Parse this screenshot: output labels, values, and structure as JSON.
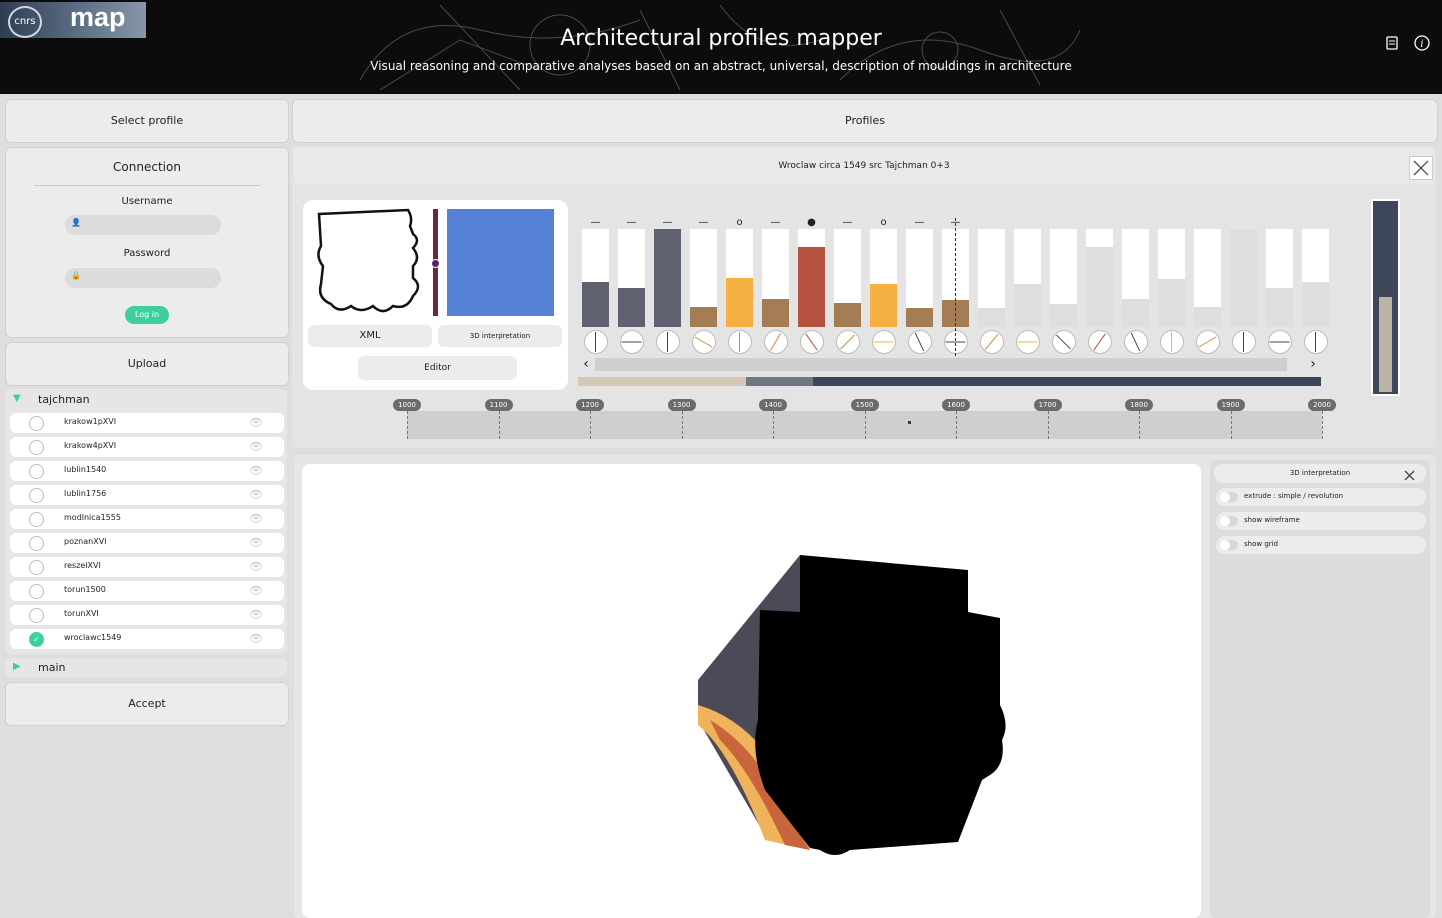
{
  "header": {
    "logo_cnrs": "cnrs",
    "logo_map": "map",
    "title": "Architectural profiles mapper",
    "subtitle": "Visual reasoning and comparative analyses based on an abstract, universal, description of mouldings in architecture",
    "icons": [
      "book-icon",
      "info-icon"
    ]
  },
  "left": {
    "select_profile_label": "Select profile",
    "connection": {
      "title": "Connection",
      "username_label": "Username",
      "password_label": "Password",
      "username_value": "",
      "password_value": "",
      "login_label": "Log in"
    },
    "upload_label": "Upload",
    "tree": {
      "group1": "tajchman",
      "items": [
        {
          "label": "krakow1pXVI",
          "checked": false
        },
        {
          "label": "krakow4pXVI",
          "checked": false
        },
        {
          "label": "lublin1540",
          "checked": false
        },
        {
          "label": "lublin1756",
          "checked": false
        },
        {
          "label": "modlnica1555",
          "checked": false
        },
        {
          "label": "poznanXVI",
          "checked": false
        },
        {
          "label": "reszelXVI",
          "checked": false
        },
        {
          "label": "torun1500",
          "checked": false
        },
        {
          "label": "torunXVI",
          "checked": false
        },
        {
          "label": "wroclawc1549",
          "checked": true
        }
      ],
      "group2": "main"
    },
    "accept_label": "Accept"
  },
  "profiles": {
    "tab_label": "Profiles",
    "profile_title": "Wroclaw circa 1549 src Tajchman 0+3",
    "xml_label": "XML",
    "interp_label": "3D interpretation",
    "editor_label": "Editor",
    "prev_arrow": "‹",
    "next_arrow": "›",
    "bars": [
      {
        "value": 0.46,
        "color": "#5f6170",
        "marker": "—"
      },
      {
        "value": 0.4,
        "color": "#5f6170",
        "marker": "—"
      },
      {
        "value": 1.0,
        "color": "#5f6170",
        "marker": "—"
      },
      {
        "value": 0.2,
        "color": "#a47d55",
        "marker": "—"
      },
      {
        "value": 0.5,
        "color": "#f4b040",
        "marker": "o"
      },
      {
        "value": 0.29,
        "color": "#a47d55",
        "marker": "—"
      },
      {
        "value": 0.82,
        "color": "#b85240",
        "marker": "●"
      },
      {
        "value": 0.24,
        "color": "#a47d55",
        "marker": "—"
      },
      {
        "value": 0.44,
        "color": "#f4b040",
        "marker": "o"
      },
      {
        "value": 0.19,
        "color": "#a47d55",
        "marker": "—"
      },
      {
        "value": 0.28,
        "color": "#a47d55",
        "marker": "—"
      },
      {
        "value": 0.19,
        "color": "#dedede",
        "marker": ""
      },
      {
        "value": 0.44,
        "color": "#dedede",
        "marker": ""
      },
      {
        "value": 0.23,
        "color": "#dedede",
        "marker": ""
      },
      {
        "value": 0.82,
        "color": "#dedede",
        "marker": ""
      },
      {
        "value": 0.29,
        "color": "#dedede",
        "marker": ""
      },
      {
        "value": 0.49,
        "color": "#dedede",
        "marker": ""
      },
      {
        "value": 0.2,
        "color": "#dedede",
        "marker": ""
      },
      {
        "value": 1.0,
        "color": "#dedede",
        "marker": ""
      },
      {
        "value": 0.4,
        "color": "#dedede",
        "marker": ""
      },
      {
        "value": 0.46,
        "color": "#dedede",
        "marker": ""
      }
    ],
    "dial_angles": [
      0,
      90,
      0,
      -60,
      0,
      30,
      -35,
      45,
      90,
      -25,
      90,
      40,
      90,
      -45,
      35,
      -25,
      0,
      60,
      0,
      90,
      0
    ],
    "dial_colors": [
      "#444",
      "#444",
      "#444",
      "#c84",
      "#c84",
      "#c84",
      "#b85240",
      "#c84",
      "#f4b040",
      "#444",
      "#444",
      "#c84",
      "#f4b040",
      "#444",
      "#b85240",
      "#444",
      "#f4b040",
      "#c84",
      "#444",
      "#444",
      "#444"
    ],
    "timeline": {
      "ticks": [
        "1000",
        "1100",
        "1200",
        "1300",
        "1400",
        "1500",
        "1600",
        "1700",
        "1800",
        "1900",
        "2000"
      ],
      "marker_year": 1549
    }
  },
  "viewer": {
    "panel_title": "3D interpretation",
    "toggles": [
      {
        "label": "extrude : simple / revolution",
        "on": false
      },
      {
        "label": "show wireframe",
        "on": false
      },
      {
        "label": "show grid",
        "on": false
      }
    ]
  }
}
